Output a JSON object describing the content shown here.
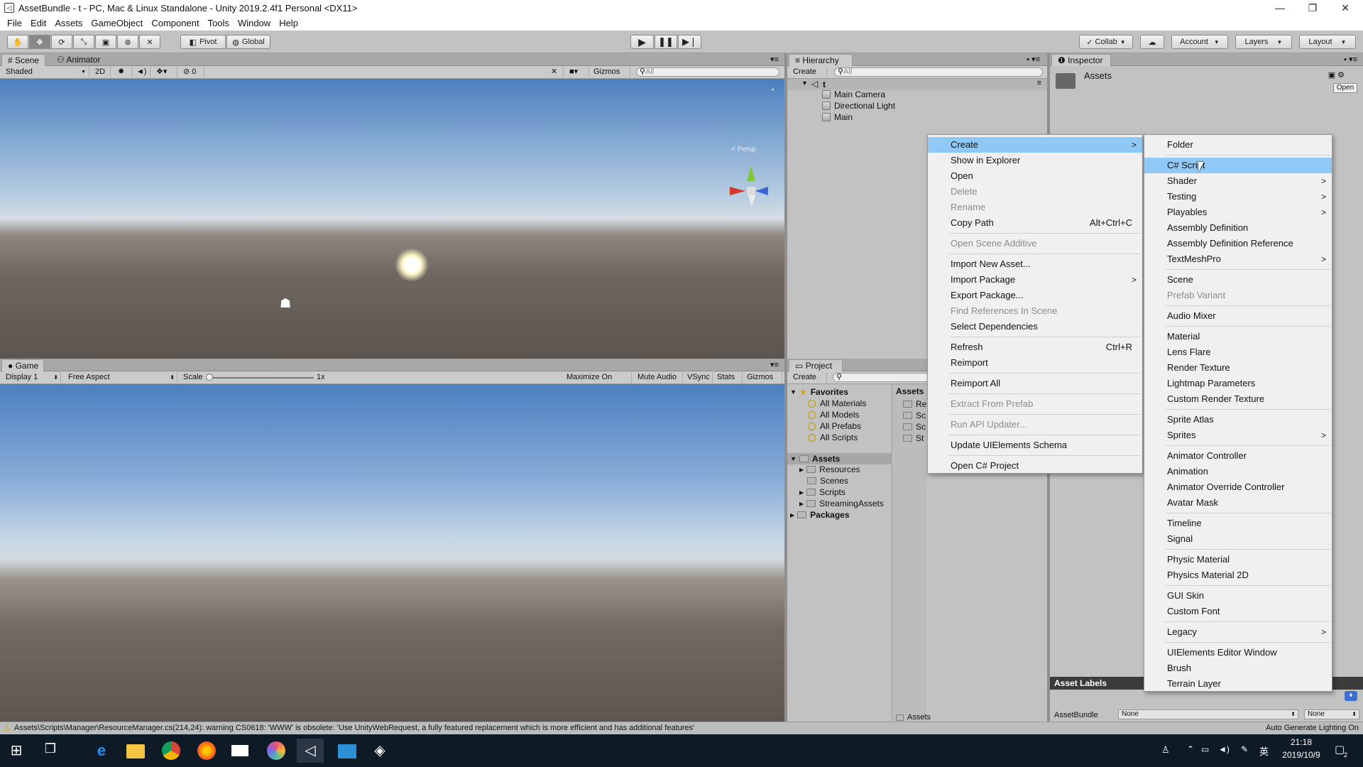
{
  "window": {
    "title": "AssetBundle - t - PC, Mac & Linux Standalone - Unity 2019.2.4f1 Personal <DX11>",
    "minimize": "—",
    "maximize": "❐",
    "close": "✕"
  },
  "menubar": [
    "File",
    "Edit",
    "Assets",
    "GameObject",
    "Component",
    "Tools",
    "Window",
    "Help"
  ],
  "toolbar": {
    "pivot": "Pivot",
    "global": "Global",
    "collab": "Collab",
    "account": "Account",
    "layers": "Layers",
    "layout": "Layout"
  },
  "scene": {
    "tab_scene": "Scene",
    "tab_animator": "Animator",
    "shading": "Shaded",
    "mode2d": "2D",
    "fx_count": "0",
    "gizmos": "Gizmos",
    "search_placeholder": "All",
    "persp": "< Persp"
  },
  "game": {
    "tab": "Game",
    "display": "Display 1",
    "aspect": "Free Aspect",
    "scale_label": "Scale",
    "scale_value": "1x",
    "maximize": "Maximize On Play",
    "mute": "Mute Audio",
    "vsync": "VSync",
    "stats": "Stats",
    "gizmos": "Gizmos"
  },
  "hierarchy": {
    "tab": "Hierarchy",
    "create": "Create",
    "search_placeholder": "All",
    "scene_name": "t",
    "items": [
      "Main Camera",
      "Directional Light",
      "Main"
    ]
  },
  "inspector": {
    "tab": "Inspector",
    "asset_title": "Assets",
    "open": "Open",
    "asset_labels": "Asset Labels",
    "assetbundle_label": "AssetBundle",
    "assetbundle_value": "None",
    "variant_value": "None"
  },
  "project": {
    "tab": "Project",
    "create": "Create",
    "favorites": "Favorites",
    "fav_items": [
      "All Materials",
      "All Models",
      "All Prefabs",
      "All Scripts"
    ],
    "assets": "Assets",
    "asset_folders": [
      "Resources",
      "Scenes",
      "Scripts",
      "StreamingAssets"
    ],
    "packages": "Packages",
    "right_header": "Assets",
    "right_items": [
      "Re",
      "Sc",
      "Sc",
      "St"
    ],
    "footer": "Assets"
  },
  "context_menu": [
    {
      "label": "Create",
      "arrow": ">",
      "state": "highlight"
    },
    {
      "label": "Show in Explorer"
    },
    {
      "label": "Open"
    },
    {
      "label": "Delete",
      "state": "disabled"
    },
    {
      "label": "Rename",
      "state": "disabled"
    },
    {
      "label": "Copy Path",
      "shortcut": "Alt+Ctrl+C"
    },
    {
      "sep": true
    },
    {
      "label": "Open Scene Additive",
      "state": "disabled"
    },
    {
      "sep": true
    },
    {
      "label": "Import New Asset..."
    },
    {
      "label": "Import Package",
      "arrow": ">"
    },
    {
      "label": "Export Package..."
    },
    {
      "label": "Find References In Scene",
      "state": "disabled"
    },
    {
      "label": "Select Dependencies"
    },
    {
      "sep": true
    },
    {
      "label": "Refresh",
      "shortcut": "Ctrl+R"
    },
    {
      "label": "Reimport"
    },
    {
      "sep": true
    },
    {
      "label": "Reimport All"
    },
    {
      "sep": true
    },
    {
      "label": "Extract From Prefab",
      "state": "disabled"
    },
    {
      "sep": true
    },
    {
      "label": "Run API Updater...",
      "state": "disabled"
    },
    {
      "sep": true
    },
    {
      "label": "Update UIElements Schema"
    },
    {
      "sep": true
    },
    {
      "label": "Open C# Project"
    }
  ],
  "create_submenu": [
    {
      "label": "Folder"
    },
    {
      "sep": true
    },
    {
      "label": "C# Script",
      "state": "highlight"
    },
    {
      "label": "Shader",
      "arrow": ">"
    },
    {
      "label": "Testing",
      "arrow": ">"
    },
    {
      "label": "Playables",
      "arrow": ">"
    },
    {
      "label": "Assembly Definition"
    },
    {
      "label": "Assembly Definition Reference"
    },
    {
      "label": "TextMeshPro",
      "arrow": ">"
    },
    {
      "sep": true
    },
    {
      "label": "Scene"
    },
    {
      "label": "Prefab Variant",
      "state": "disabled"
    },
    {
      "sep": true
    },
    {
      "label": "Audio Mixer"
    },
    {
      "sep": true
    },
    {
      "label": "Material"
    },
    {
      "label": "Lens Flare"
    },
    {
      "label": "Render Texture"
    },
    {
      "label": "Lightmap Parameters"
    },
    {
      "label": "Custom Render Texture"
    },
    {
      "sep": true
    },
    {
      "label": "Sprite Atlas"
    },
    {
      "label": "Sprites",
      "arrow": ">"
    },
    {
      "sep": true
    },
    {
      "label": "Animator Controller"
    },
    {
      "label": "Animation"
    },
    {
      "label": "Animator Override Controller"
    },
    {
      "label": "Avatar Mask"
    },
    {
      "sep": true
    },
    {
      "label": "Timeline"
    },
    {
      "label": "Signal"
    },
    {
      "sep": true
    },
    {
      "label": "Physic Material"
    },
    {
      "label": "Physics Material 2D"
    },
    {
      "sep": true
    },
    {
      "label": "GUI Skin"
    },
    {
      "label": "Custom Font"
    },
    {
      "sep": true
    },
    {
      "label": "Legacy",
      "arrow": ">"
    },
    {
      "sep": true
    },
    {
      "label": "UIElements Editor Window"
    },
    {
      "label": "Brush"
    },
    {
      "label": "Terrain Layer"
    }
  ],
  "statusbar": {
    "warning": "Assets\\Scripts\\Manager\\ResourceManager.cs(214,24): warning CS0618: 'WWW' is obsolete: 'Use UnityWebRequest, a fully featured replacement which is more efficient and has additional features'",
    "lighting": "Auto Generate Lighting On"
  },
  "taskbar": {
    "time": "21:18",
    "date": "2019/10/9",
    "ime": "英",
    "notif_count": "2"
  }
}
